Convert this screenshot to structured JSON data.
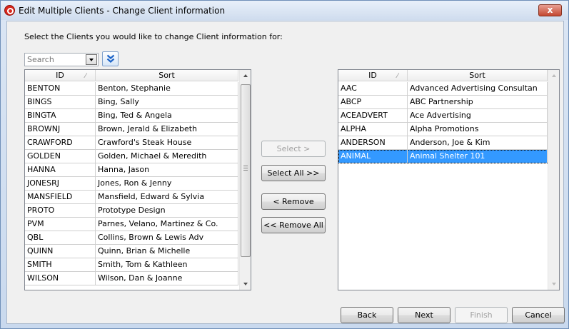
{
  "window": {
    "title": "Edit Multiple Clients - Change Client information",
    "close_label": "x"
  },
  "instruction": "Select the Clients you would like to change Client information for:",
  "search": {
    "placeholder": "Search"
  },
  "left_grid": {
    "columns": [
      "ID",
      "Sort"
    ],
    "rows": [
      [
        "BENTON",
        "Benton, Stephanie"
      ],
      [
        "BINGS",
        "Bing, Sally"
      ],
      [
        "BINGTA",
        "Bing, Ted & Angela"
      ],
      [
        "BROWNJ",
        "Brown, Jerald & Elizabeth"
      ],
      [
        "CRAWFORD",
        "Crawford's Steak House"
      ],
      [
        "GOLDEN",
        "Golden, Michael & Meredith"
      ],
      [
        "HANNA",
        "Hanna, Jason"
      ],
      [
        "JONESRJ",
        "Jones, Ron & Jenny"
      ],
      [
        "MANSFIELD",
        "Mansfield, Edward & Sylvia"
      ],
      [
        "PROTO",
        "Prototype Design"
      ],
      [
        "PVM",
        "Parnes, Velano, Martinez & Co."
      ],
      [
        "QBL",
        "Collins, Brown & Lewis Adv"
      ],
      [
        "QUINN",
        "Quinn, Brian & Michelle"
      ],
      [
        "SMITH",
        "Smith, Tom & Kathleen"
      ],
      [
        "WILSON",
        "Wilson, Dan & Joanne"
      ]
    ]
  },
  "right_grid": {
    "columns": [
      "ID",
      "Sort"
    ],
    "rows": [
      [
        "AAC",
        "Advanced Advertising Consultan"
      ],
      [
        "ABCP",
        "ABC Partnership"
      ],
      [
        "ACEADVERT",
        "Ace Advertising"
      ],
      [
        "ALPHA",
        "Alpha Promotions"
      ],
      [
        "ANDERSON",
        "Anderson, Joe & Kim"
      ],
      [
        "ANIMAL",
        "Animal Shelter 101"
      ]
    ],
    "selected_index": 5
  },
  "transfer_buttons": {
    "select": "Select >",
    "select_all": "Select All >>",
    "remove": "< Remove",
    "remove_all": "<< Remove All"
  },
  "footer_buttons": {
    "back": "Back",
    "next": "Next",
    "finish": "Finish",
    "cancel": "Cancel"
  },
  "colors": {
    "selection": "#3399ff",
    "close_button": "#c44731",
    "app_icon": "#d9271d"
  }
}
